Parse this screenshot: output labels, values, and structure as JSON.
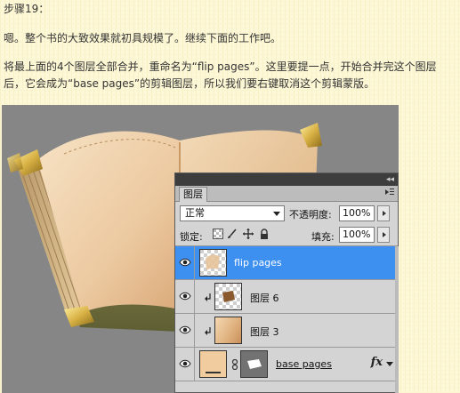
{
  "article": {
    "step_title": "步骤19：",
    "intro": "嗯。整个书的大致效果就初具规模了。继续下面的工作吧。",
    "body_line1": "将最上面的4个图层全部合并，重命名为“flip pages”。这里要提一点，开始合并完这个图层",
    "body_line2": "后，它会成为“base pages”的剪辑图层，所以我们要右键取消这个剪辑蒙版。"
  },
  "layers_panel": {
    "tab_label": "图层",
    "blend_mode": "正常",
    "opacity_label": "不透明度:",
    "opacity_value": "100%",
    "lock_label": "锁定:",
    "fill_label": "填充:",
    "fill_value": "100%",
    "layers": [
      {
        "name": "flip pages",
        "selected": true,
        "clipped": false
      },
      {
        "name": "图层 6",
        "selected": false,
        "clipped": true
      },
      {
        "name": "图层 3",
        "selected": false,
        "clipped": true
      },
      {
        "name": "base pages",
        "selected": false,
        "clipped": false,
        "has_mask": true,
        "has_fx": true
      }
    ],
    "fx_label": "fx"
  },
  "colors": {
    "canvas_bg": "#868686",
    "selection": "#3d8ff0",
    "page_bg": "#fdf8d8"
  }
}
